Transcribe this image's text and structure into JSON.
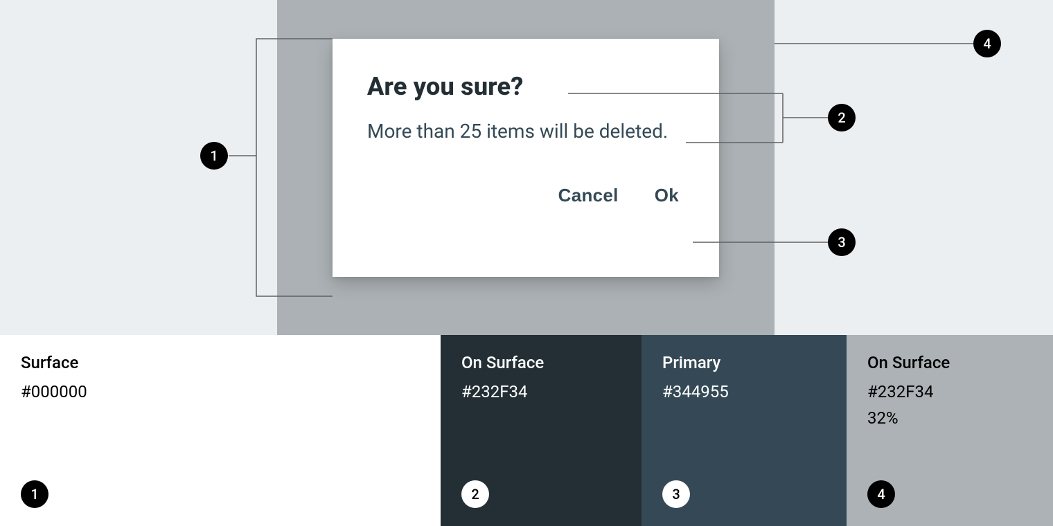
{
  "dialog": {
    "title": "Are you sure?",
    "body": "More than 25 items will be deleted.",
    "cancel_label": "Cancel",
    "ok_label": "Ok"
  },
  "annotations": {
    "a1": "1",
    "a2": "2",
    "a3": "3",
    "a4": "4"
  },
  "swatches": [
    {
      "label": "Surface",
      "hex": "#000000",
      "opacity": "",
      "badge": "1",
      "bg": "#FFFFFF",
      "fg": "#000000",
      "badge_style": "black"
    },
    {
      "label": "On Surface",
      "hex": "#232F34",
      "opacity": "",
      "badge": "2",
      "bg": "#232F34",
      "fg": "#FFFFFF",
      "badge_style": "white"
    },
    {
      "label": "Primary",
      "hex": "#344955",
      "opacity": "",
      "badge": "3",
      "bg": "#344955",
      "fg": "#FFFFFF",
      "badge_style": "white"
    },
    {
      "label": "On Surface",
      "hex": "#232F34",
      "opacity": "32%",
      "badge": "4",
      "bg": "#ACB2B5",
      "fg": "#000000",
      "badge_style": "black"
    }
  ]
}
